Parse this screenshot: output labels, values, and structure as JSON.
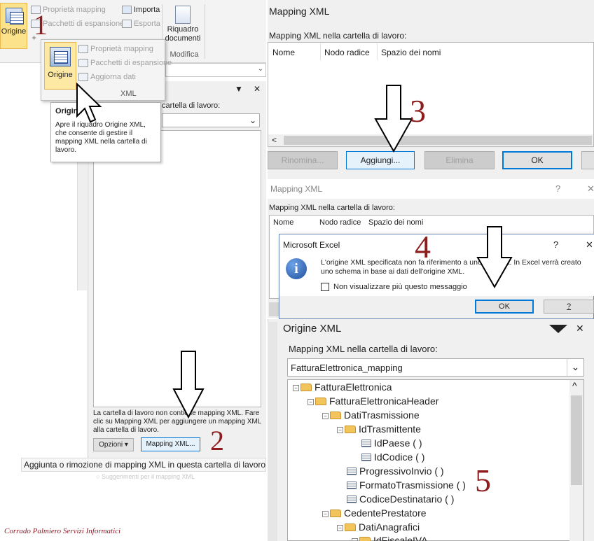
{
  "ribbon": {
    "origine_label": "Origine",
    "proprieta_mapping": "Proprietà mapping",
    "pacchetti_espansione": "Pacchetti di espansione",
    "importa": "Importa",
    "esporta": "Esporta",
    "riquadro_documenti": "Riquadro documenti",
    "modifica": "Modifica"
  },
  "popup": {
    "origine_label": "Origine",
    "proprieta_mapping": "Proprietà mapping",
    "pacchetti_espansione": "Pacchetti di espansione",
    "aggiorna_dati": "Aggiorna dati",
    "group_label": "XML"
  },
  "tooltip": {
    "title": "Origine",
    "text": "Apre il riquadro Origine XML, che consente di gestire il mapping XML nella cartella di lavoro."
  },
  "left_pane": {
    "header_partial": "cartella di lavoro:",
    "empty_message": "La cartella di lavoro non contiene mapping XML. Fare clic su Mapping XML per aggiungere un mapping XML alla cartella di lavoro.",
    "opzioni_button": "Opzioni",
    "mapping_button": "Mapping XML...",
    "status_tip": "Aggiunta o rimozione di mapping XML in questa cartella di lavoro",
    "faded_link": "Suggerimenti per il mapping XML"
  },
  "watermark": "Corrado Palmiero Servizi Informatici",
  "steps": [
    "1",
    "2",
    "3",
    "4",
    "5"
  ],
  "dialog1": {
    "title": "Mapping XML",
    "label": "Mapping XML nella cartella di lavoro:",
    "columns": [
      "Nome",
      "Nodo radice",
      "Spazio dei nomi"
    ],
    "rinomina": "Rinomina...",
    "aggiungi": "Aggiungi...",
    "elimina": "Elimina",
    "ok": "OK"
  },
  "dialog2": {
    "title": "Mapping XML",
    "help": "?",
    "label": "Mapping XML nella cartella di lavoro:",
    "columns": [
      "Nome",
      "Nodo radice",
      "Spazio dei nomi"
    ]
  },
  "msgbox": {
    "title": "Microsoft Excel",
    "help": "?",
    "message": "L'origine XML specificata non fa riferimento a uno schema. In Excel verrà creato uno schema in base ai dati dell'origine XML.",
    "checkbox": "Non visualizzare più questo messaggio",
    "ok": "OK",
    "help_button": "?"
  },
  "xml_source": {
    "title": "Origine XML",
    "label": "Mapping XML nella cartella di lavoro:",
    "selected_map": "FatturaElettronica_mapping",
    "tree": [
      {
        "label": "FatturaElettronica",
        "type": "root"
      },
      {
        "label": "FatturaElettronicaHeader",
        "type": "folder"
      },
      {
        "label": "DatiTrasmissione",
        "type": "folder"
      },
      {
        "label": "IdTrasmittente",
        "type": "folder"
      },
      {
        "label": "IdPaese  (  )",
        "type": "leaf"
      },
      {
        "label": "IdCodice  (  )",
        "type": "leaf"
      },
      {
        "label": "ProgressivoInvio  (  )",
        "type": "leaf"
      },
      {
        "label": "FormatoTrasmissione  (  )",
        "type": "leaf"
      },
      {
        "label": "CodiceDestinatario  (  )",
        "type": "leaf"
      },
      {
        "label": "CedentePrestatore",
        "type": "folder"
      },
      {
        "label": "DatiAnagrafici",
        "type": "folder"
      },
      {
        "label": "IdFiscaleIVA",
        "type": "folder"
      }
    ]
  }
}
